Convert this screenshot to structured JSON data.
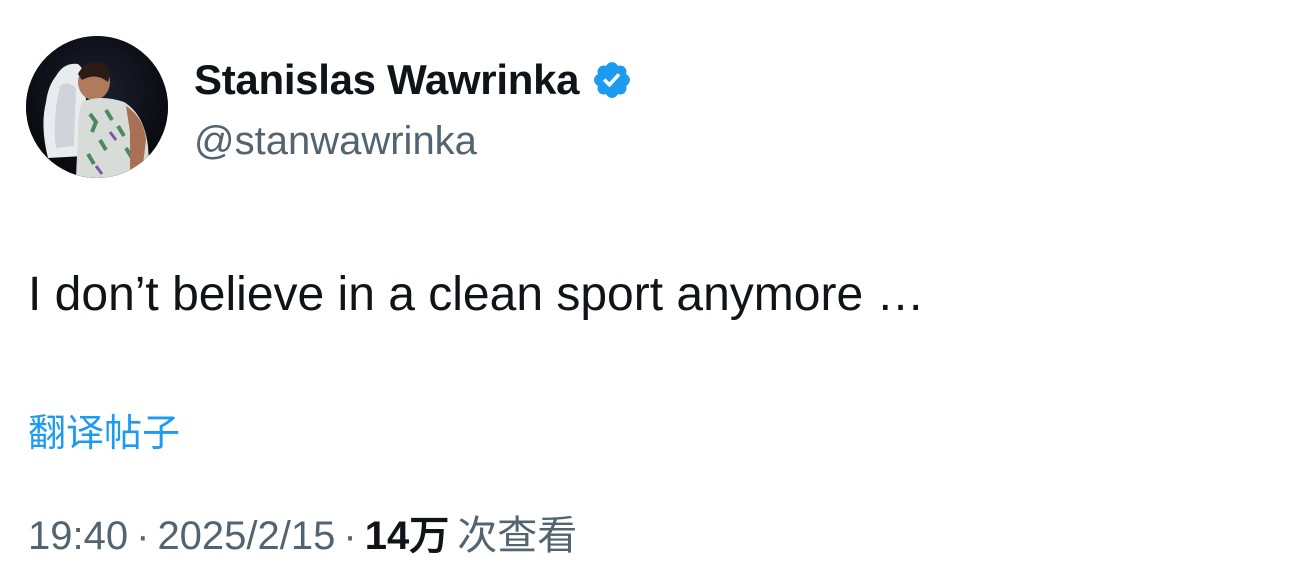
{
  "tweet": {
    "author": {
      "display_name": "Stanislas Wawrinka",
      "handle": "@stanwawrinka",
      "verified": true,
      "verified_color": "#1d9bf0"
    },
    "text": "I don’t believe in a clean sport anymore …",
    "translate_label": "翻译帖子",
    "time": "19:40",
    "date": "2025/2/15",
    "separator": "·",
    "views_count": "14万",
    "views_label": "次查看"
  },
  "colors": {
    "link": "#1d9bf0",
    "text_primary": "#0f1419",
    "text_secondary": "#536471"
  }
}
